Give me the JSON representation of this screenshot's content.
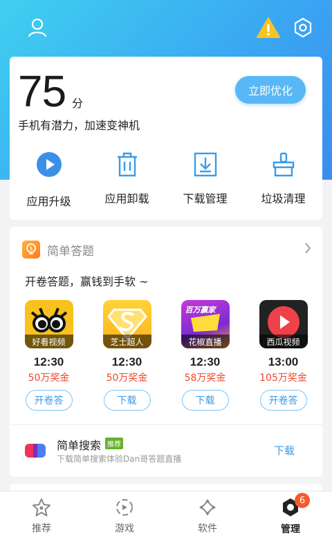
{
  "topbar": {
    "left_icon": "user-icon",
    "right_icons": [
      "warning-icon",
      "settings-icon"
    ]
  },
  "score": {
    "value": "75",
    "unit": "分",
    "subtitle": "手机有潜力，加速变神机",
    "button": "立即优化"
  },
  "tools": [
    {
      "icon": "play-circle-icon",
      "label": "应用升级"
    },
    {
      "icon": "trash-icon",
      "label": "应用卸载"
    },
    {
      "icon": "download-icon",
      "label": "下载管理"
    },
    {
      "icon": "broom-icon",
      "label": "垃圾清理"
    }
  ],
  "quiz": {
    "title": "简单答题",
    "description": "开卷答题，赢钱到手软 ~",
    "apps": [
      {
        "name": "好看视频",
        "time": "12:30",
        "prize": "50万奖金",
        "button": "开卷答"
      },
      {
        "name": "芝士超人",
        "time": "12:30",
        "prize": "50万奖金",
        "button": "下载"
      },
      {
        "name": "花椒直播",
        "time": "12:30",
        "prize": "58万奖金",
        "button": "下载"
      },
      {
        "name": "西瓜视频",
        "time": "13:00",
        "prize": "105万奖金",
        "button": "开卷答"
      }
    ],
    "search": {
      "title": "简单搜索",
      "tag": "推荐",
      "description": "下载简单搜索体验Dan哥答题直播",
      "button": "下载"
    }
  },
  "huajiao_banner": "百万赢家",
  "nav": [
    {
      "icon": "star-icon",
      "label": "推荐"
    },
    {
      "icon": "game-icon",
      "label": "游戏"
    },
    {
      "icon": "software-icon",
      "label": "软件"
    },
    {
      "icon": "manage-icon",
      "label": "管理",
      "badge": "6",
      "active": true
    }
  ],
  "colors": {
    "accent": "#3aa9f2",
    "prize": "#f0482b",
    "badge": "#f45a2d"
  }
}
